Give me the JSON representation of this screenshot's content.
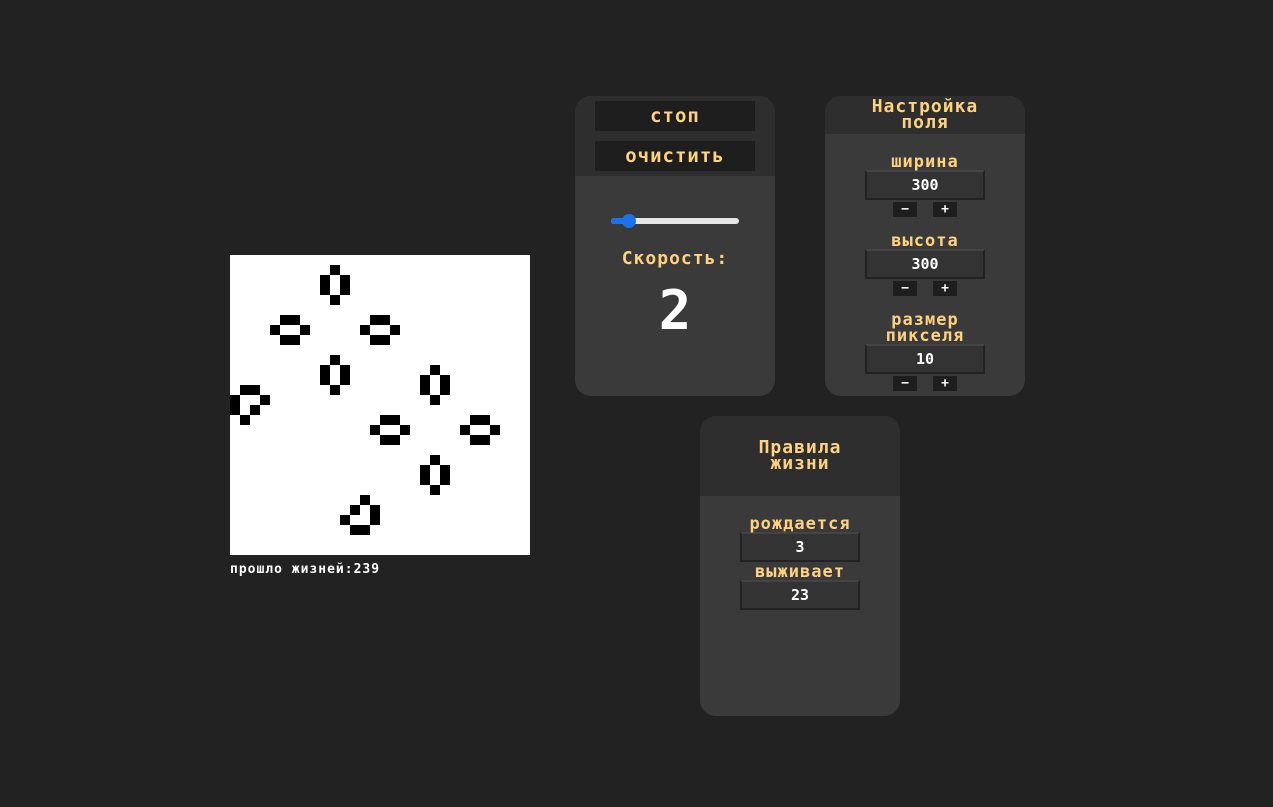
{
  "board": {
    "background": "#ffffff",
    "cell_color": "#000000",
    "columns": 30,
    "rows": 30,
    "live_cells": [
      [
        10,
        1
      ],
      [
        9,
        2
      ],
      [
        11,
        2
      ],
      [
        9,
        3
      ],
      [
        11,
        3
      ],
      [
        10,
        4
      ],
      [
        5,
        6
      ],
      [
        6,
        6
      ],
      [
        4,
        7
      ],
      [
        7,
        7
      ],
      [
        5,
        8
      ],
      [
        6,
        8
      ],
      [
        14,
        6
      ],
      [
        15,
        6
      ],
      [
        13,
        7
      ],
      [
        16,
        7
      ],
      [
        14,
        8
      ],
      [
        15,
        8
      ],
      [
        10,
        10
      ],
      [
        9,
        11
      ],
      [
        11,
        11
      ],
      [
        9,
        12
      ],
      [
        11,
        12
      ],
      [
        10,
        13
      ],
      [
        20,
        11
      ],
      [
        19,
        12
      ],
      [
        21,
        12
      ],
      [
        19,
        13
      ],
      [
        21,
        13
      ],
      [
        20,
        14
      ],
      [
        1,
        13
      ],
      [
        2,
        13
      ],
      [
        0,
        14
      ],
      [
        3,
        14
      ],
      [
        0,
        15
      ],
      [
        2,
        15
      ],
      [
        1,
        16
      ],
      [
        15,
        16
      ],
      [
        16,
        16
      ],
      [
        14,
        17
      ],
      [
        17,
        17
      ],
      [
        15,
        18
      ],
      [
        16,
        18
      ],
      [
        24,
        16
      ],
      [
        25,
        16
      ],
      [
        23,
        17
      ],
      [
        26,
        17
      ],
      [
        24,
        18
      ],
      [
        25,
        18
      ],
      [
        20,
        20
      ],
      [
        19,
        21
      ],
      [
        21,
        21
      ],
      [
        19,
        22
      ],
      [
        21,
        22
      ],
      [
        20,
        23
      ],
      [
        13,
        24
      ],
      [
        12,
        25
      ],
      [
        14,
        25
      ],
      [
        11,
        26
      ],
      [
        14,
        26
      ],
      [
        12,
        27
      ],
      [
        13,
        27
      ]
    ]
  },
  "generation": {
    "label": "прошло жизней:",
    "value": "239"
  },
  "controls": {
    "stop_label": "стоп",
    "clear_label": "очистить",
    "speed_label": "Скорость:",
    "speed_value": "2",
    "speed_slider_fraction": 0.14,
    "slider_color": "#1a73e8"
  },
  "field_settings": {
    "title_line1": "Настройка",
    "title_line2": "поля",
    "width_label": "ширина",
    "width_value": "300",
    "height_label": "высота",
    "height_value": "300",
    "pixel_label_line1": "размер",
    "pixel_label_line2": "пикселя",
    "pixel_value": "10",
    "minus_label": "−",
    "plus_label": "+"
  },
  "rules": {
    "title_line1": "Правила",
    "title_line2": "жизни",
    "born_label": "рождается",
    "born_value": "3",
    "survive_label": "выживает",
    "survive_value": "23"
  },
  "colors": {
    "page_background": "#222222",
    "panel": "#3a3a3a",
    "accent_text": "#ffd27f"
  }
}
